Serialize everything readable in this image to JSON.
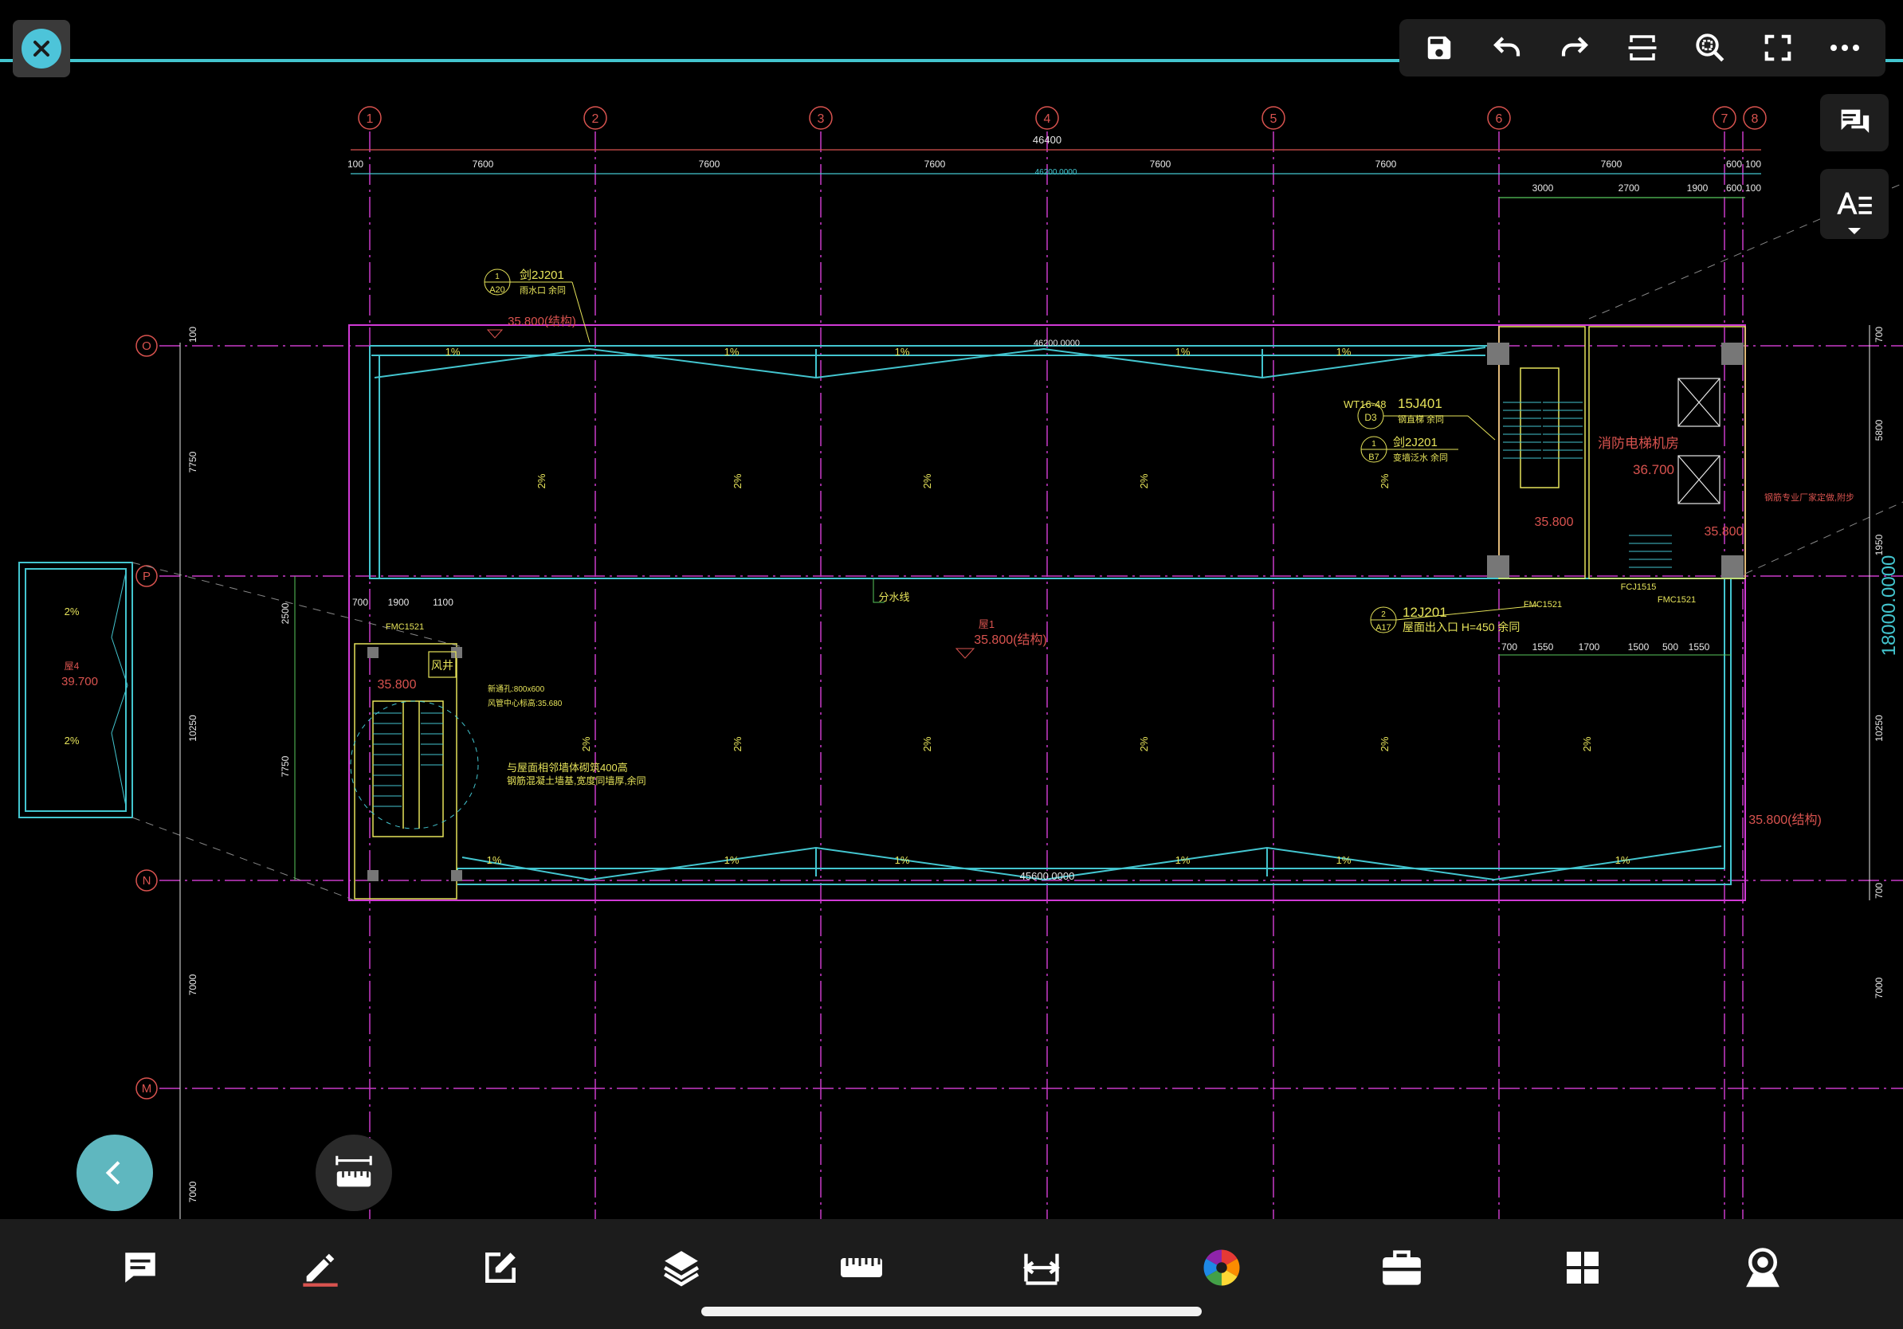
{
  "drawing": {
    "grid_top": [
      "1",
      "2",
      "3",
      "4",
      "5",
      "6",
      "7",
      "8"
    ],
    "grid_left": [
      "O",
      "P",
      "N",
      "M"
    ],
    "dims_top_row": [
      "100",
      "7600",
      "7600",
      "7600",
      "7600",
      "7600",
      "7600",
      "600",
      "100"
    ],
    "overall_width": "46400",
    "overall_width_cyan": "46200.0000",
    "dims_right_top": [
      "3000",
      "2700",
      "1900",
      "600",
      "100"
    ],
    "dims_left_vertical": [
      "100",
      "7750",
      "10250",
      "7000",
      "7000"
    ],
    "dims_left_inner": [
      "2500",
      "7750"
    ],
    "dims_right_vertical": [
      "700",
      "5800",
      "1950",
      "10250",
      "700",
      "7000"
    ],
    "right_big_dim": "18000.0000",
    "bottom_cyan": "45600.0000",
    "top_cyan": "46200.0000",
    "slopes_1pct": "1%",
    "slopes_2pct": "2%",
    "elev_main": "35.800(结构)",
    "elev_roof1": "屋1",
    "elev_roof1_val": "35.800(结构)",
    "elev_stair": "35.800",
    "elev_room": "36.700",
    "elev_right": "35.800(结构)",
    "elev_roof4": "屋4",
    "elev_roof4_val": "39.700",
    "room_name": "消防电梯机房",
    "label_fengjing": "风井",
    "label_fenshuixian": "分水线",
    "ref_12J201_top": "剑2J201",
    "ref_12J201_top_sub": "雨水口 余同",
    "ref_A20": "A20",
    "ref_15J401": "15J401",
    "ref_15J401_sub": "钢直梯 余同",
    "ref_WT": "WT16-48",
    "ref_D3": "D3",
    "ref_12J201_mid": "剑2J201",
    "ref_12J201_mid_sub": "变墙泛水 余同",
    "ref_B7": "B7",
    "ref_12J201_bot": "12J201",
    "ref_12J201_bot_sub": "屋面出入口 H=450 余同",
    "ref_A17": "A17",
    "label_fmc1521": "FMC1521",
    "label_fcj1515": "FCJ1515",
    "note_yantong": "与屋面相邻墙体砌筑400高",
    "note_yantong2": "钢筋混凝土墙基,宽度同墙厚,余同",
    "note_ventilation": "新通孔:800x600",
    "note_ventilation2": "风管中心标高:35.680",
    "note_right": "钢筋专业厂家定做,附步",
    "dims_bottom_right": [
      "700",
      "1550",
      "1700",
      "1500",
      "500",
      "1550"
    ],
    "dims_left_small": [
      "700",
      "1900",
      "1100"
    ]
  },
  "toolbar": {
    "items": [
      "save-icon",
      "undo-icon",
      "redo-icon",
      "crop-icon",
      "zoom-icon",
      "fullscreen-icon",
      "more-icon"
    ]
  },
  "side": [
    "comments-icon",
    "text-style-icon"
  ],
  "bottom_bar": [
    "comment-icon",
    "pen-icon",
    "edit-icon",
    "layers-icon",
    "ruler-icon",
    "measure-icon",
    "color-wheel-icon",
    "toolbox-icon",
    "grid-icon",
    "cloud-icon"
  ],
  "colors": {
    "cyan": "#43c5cf",
    "magenta": "#d13ad6",
    "yellow": "#e6e35a",
    "red": "#d9534f",
    "white": "#e8e8e8",
    "green": "#58c95c"
  }
}
